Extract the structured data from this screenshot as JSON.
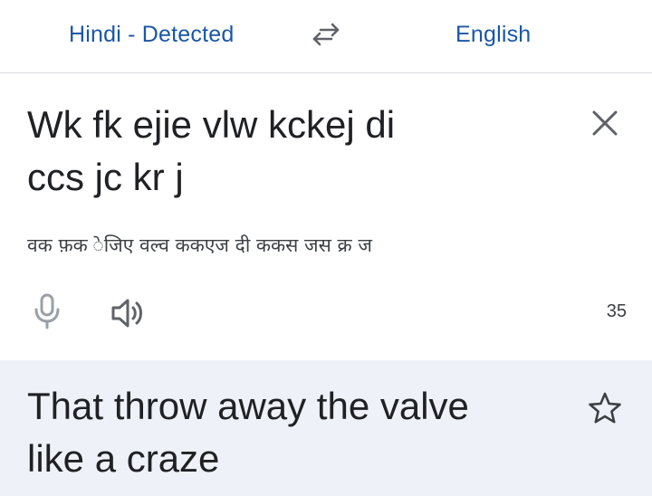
{
  "language_bar": {
    "source_language": "Hindi - Detected",
    "target_language": "English",
    "swap_icon": "swap-arrows-icon"
  },
  "source": {
    "input_text_line1": "Wk fk ejie vlw kckej di",
    "input_text_line2": "ccs jc kr j",
    "transliteration": "वक फ़क ेजिए वल्व ककएज दी ककस जस क्र ज",
    "char_count": "35",
    "clear_icon": "close-icon",
    "mic_icon": "microphone-icon",
    "speaker_icon": "speaker-icon"
  },
  "result": {
    "translation_line1": "That throw away the valve",
    "translation_line2": "like a craze",
    "star_icon": "star-outline-icon"
  },
  "colors": {
    "accent": "#1a56a8",
    "result_background": "#eef1f7",
    "text_primary": "#202124",
    "icon_gray": "#5f6368",
    "mic_gray": "#9aa0a6"
  }
}
